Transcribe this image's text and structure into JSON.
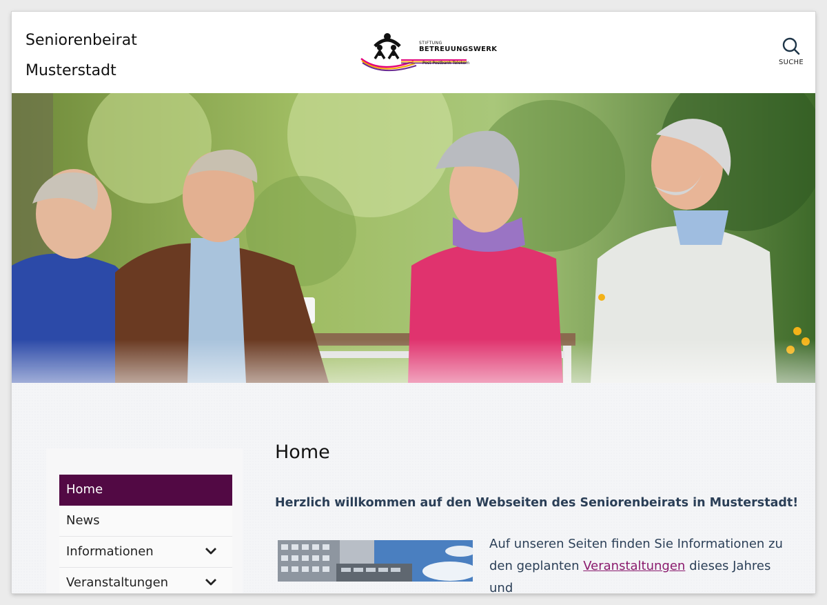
{
  "header": {
    "site_title_line1": "Seniorenbeirat",
    "site_title_line2": "Musterstadt",
    "logo": {
      "icon": "family-logo-icon",
      "small_text": "STIFTUNG",
      "main_text": "BETREUUNGSWERK",
      "sub_text": "Post Postbank Telekom"
    },
    "search_label": "SUCHE",
    "search_icon": "search-icon"
  },
  "hero": {
    "image": "seniors-at-outdoor-table-photo"
  },
  "sidebar": {
    "items": [
      {
        "label": "Home",
        "active": true
      },
      {
        "label": "News"
      },
      {
        "label": "Informationen",
        "icon": "chevron-down-icon"
      },
      {
        "label": "Veranstaltungen",
        "icon": "chevron-down-icon"
      }
    ]
  },
  "main": {
    "title": "Home",
    "welcome": "Herzlich willkommen auf den Webseiten des Seniorenbeirats in Musterstadt!",
    "intro_before": "Auf unseren Seiten finden Sie Informationen zu den geplanten ",
    "intro_link": "Veranstaltungen",
    "intro_after": " dieses Jahres und",
    "thumbnail": "city-buildings-photo"
  },
  "colors": {
    "accent": "#520944",
    "link": "#8a1a6d",
    "heading": "#2b3f57"
  }
}
